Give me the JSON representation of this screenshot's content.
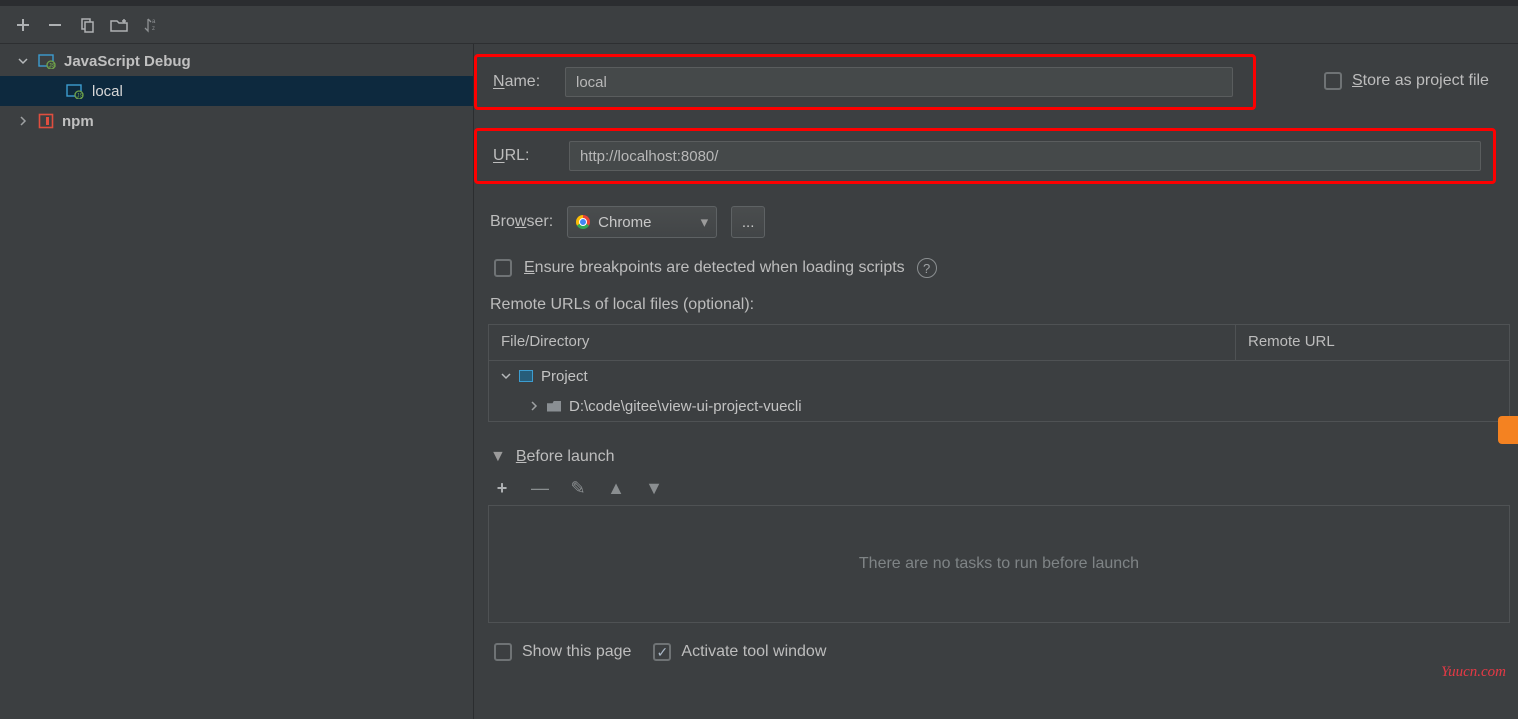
{
  "toolbar": {
    "icons": [
      "add",
      "remove",
      "copy",
      "folder-add",
      "sort"
    ]
  },
  "sidebar": {
    "items": [
      {
        "label": "JavaScript Debug",
        "expanded": true,
        "kind": "js-debug"
      },
      {
        "label": "local",
        "kind": "js-debug-config",
        "selected": true
      },
      {
        "label": "npm",
        "expanded": false,
        "kind": "npm"
      }
    ]
  },
  "form": {
    "name_label": "Name:",
    "name_value": "local",
    "store_label": "Store as project file",
    "url_label": "URL:",
    "url_value": "http://localhost:8080/",
    "browser_label": "Browser:",
    "browser_value": "Chrome",
    "browser_more": "...",
    "ensure_label": "Ensure breakpoints are detected when loading scripts",
    "remote_label": "Remote URLs of local files (optional):",
    "table": {
      "col1": "File/Directory",
      "col2": "Remote URL",
      "rows": [
        {
          "label": "Project",
          "expanded": true,
          "depth": 0,
          "icon": "project"
        },
        {
          "label": "D:\\code\\gitee\\view-ui-project-vuecli",
          "expanded": false,
          "depth": 1,
          "icon": "folder"
        }
      ]
    },
    "before_launch_label": "Before launch",
    "before_launch_empty": "There are no tasks to run before launch",
    "show_this_page": "Show this page",
    "activate_tool_window": "Activate tool window",
    "activate_tool_window_checked": true
  },
  "watermark": "Yuucn.com"
}
